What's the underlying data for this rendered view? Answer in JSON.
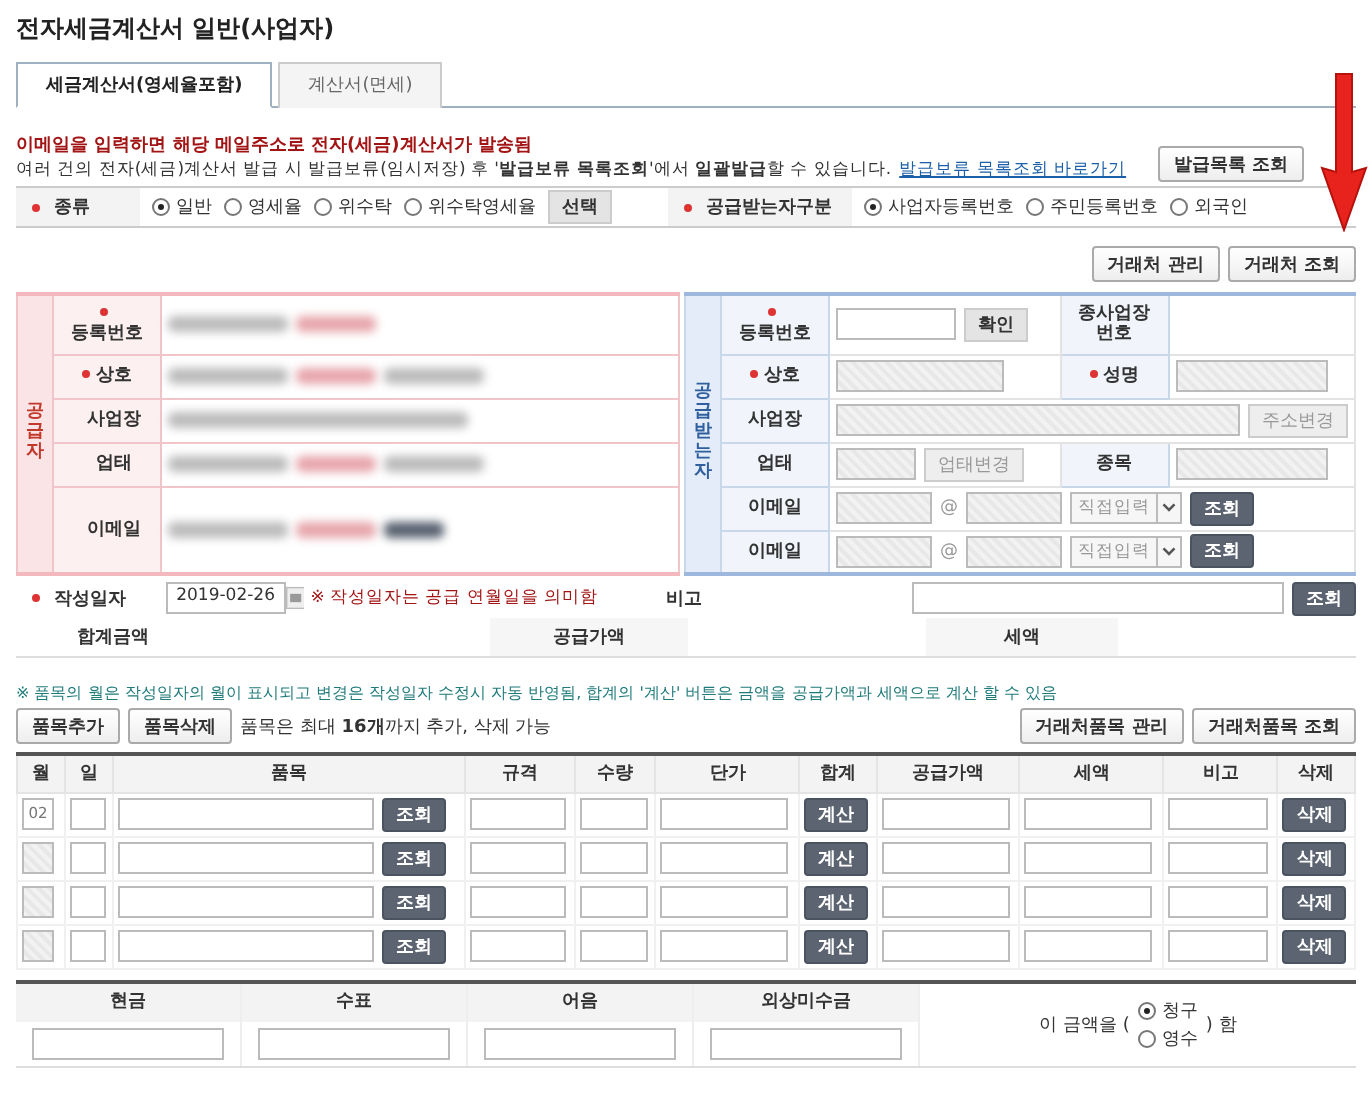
{
  "title": "전자세금계산서 일반(사업자)",
  "tabs": [
    {
      "label": "세금계산서(영세율포함)",
      "selected": true
    },
    {
      "label": "계산서(면세)",
      "selected": false
    }
  ],
  "notice": {
    "warning": "이메일을 입력하면 해당 메일주소로 전자(세금)계산서가 발송됨",
    "info": "여러 건의 전자(세금)계산서 발급 시 발급보류(임시저장) 후 '**발급보류 목록조회**'에서 **일괄발급**할 수 있습니다.",
    "link": "발급보류 목록조회 바로가기",
    "button": "발급목록 조회"
  },
  "type_row": {
    "label": "종류",
    "required": true,
    "options": [
      {
        "label": "일반",
        "selected": true
      },
      {
        "label": "영세율",
        "selected": false
      },
      {
        "label": "위수탁",
        "selected": false
      },
      {
        "label": "위수탁영세율",
        "selected": false
      }
    ],
    "select_button": "선택",
    "receiver_label": "공급받는자구분",
    "receiver_required": true,
    "receiver_options": [
      {
        "label": "사업자등록번호",
        "selected": true
      },
      {
        "label": "주민등록번호",
        "selected": false
      },
      {
        "label": "외국인",
        "selected": false
      }
    ]
  },
  "partner_buttons": [
    "거래처 관리",
    "거래처 조회"
  ],
  "supplier": {
    "heading": "공급자",
    "rows": [
      {
        "label": "등록번호",
        "required": true
      },
      {
        "label": "상호",
        "required": true
      },
      {
        "label": "사업장",
        "required": false
      },
      {
        "label": "업태",
        "required": false
      },
      {
        "label": "이메일",
        "required": false
      }
    ]
  },
  "receiver": {
    "heading": "공급받는자",
    "reg": {
      "label": "등록번호",
      "required": true
    },
    "confirm": "확인",
    "branch_label": "종사업장 번호",
    "name": {
      "label": "상호",
      "required": true
    },
    "rep": {
      "label": "성명",
      "required": true
    },
    "address_label": "사업장",
    "address_button": "주소변경",
    "business_label": "업태",
    "business_button": "업태변경",
    "item_label": "종목",
    "emails": [
      {
        "label": "이메일",
        "at": "@",
        "domain": "직접입력",
        "button": "조회"
      },
      {
        "label": "이메일",
        "at": "@",
        "domain": "직접입력",
        "button": "조회"
      }
    ]
  },
  "date_row": {
    "label": "작성일자",
    "required": true,
    "value": "2019-02-26",
    "note": "※ 작성일자는 공급 연월일을 의미함",
    "memo_label": "비고",
    "button": "조회"
  },
  "totals": [
    "합계금액",
    "공급가액",
    "세액"
  ],
  "items_note": "※ 품목의 월은 작성일자의 월이 표시되고 변경은 작성일자 수정시 자동 반영됨, 합계의 '계산' 버튼은 금액을 공급가액과 세액으로 계산 할 수 있음",
  "item_buttons": {
    "add": "품목추가",
    "remove": "품목삭제",
    "limit": "품목은 최대 **16개**까지 추가, 삭제 가능",
    "right": [
      "거래처품목 관리",
      "거래처품목 조회"
    ]
  },
  "columns": [
    "월",
    "일",
    "품목",
    "규격",
    "수량",
    "단가",
    "합계",
    "공급가액",
    "세액",
    "비고",
    "삭제"
  ],
  "rows": [
    {
      "month": "02",
      "lookup": "조회",
      "calc": "계산",
      "delete": "삭제"
    },
    {
      "lookup": "조회",
      "calc": "계산",
      "delete": "삭제"
    },
    {
      "lookup": "조회",
      "calc": "계산",
      "delete": "삭제"
    },
    {
      "lookup": "조회",
      "calc": "계산",
      "delete": "삭제"
    }
  ],
  "payment": {
    "columns": [
      "현금",
      "수표",
      "어음",
      "외상미수금"
    ],
    "prefix": "이 금액을 (",
    "suffix": ") 함",
    "options": [
      {
        "label": "청구",
        "selected": true
      },
      {
        "label": "영수",
        "selected": false
      }
    ]
  }
}
